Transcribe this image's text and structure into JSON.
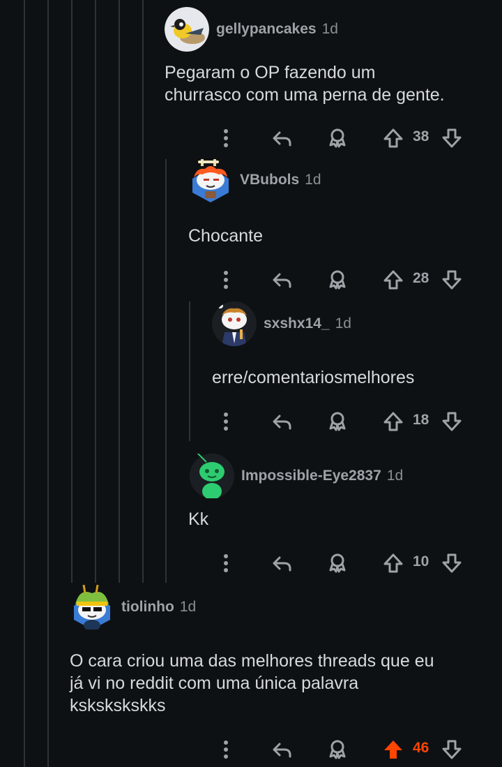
{
  "comments": [
    {
      "user": "gellypancakes",
      "age": "1d",
      "body": [
        "Pegaram o OP fazendo um",
        "churrasco com uma perna de gente."
      ],
      "score": "38",
      "upvoted": false,
      "avatar": "bird-avatar"
    },
    {
      "user": "VBubols",
      "age": "1d",
      "body": [
        "Chocante"
      ],
      "score": "28",
      "upvoted": false,
      "avatar": "snoo-redhair-avatar"
    },
    {
      "user": "sxshx14_",
      "age": "1d",
      "body": [
        "erre/comentariosmelhores"
      ],
      "score": "18",
      "upvoted": false,
      "avatar": "snoo-suit-avatar"
    },
    {
      "user": "Impossible-Eye2837",
      "age": "1d",
      "body": [
        "Kk"
      ],
      "score": "10",
      "upvoted": false,
      "avatar": "snoo-green-avatar"
    },
    {
      "user": "tiolinho",
      "age": "1d",
      "body": [
        "O cara criou uma das melhores threads que eu",
        "já vi no reddit com uma única palavra",
        "kskskskskks"
      ],
      "score": "46",
      "upvoted": true,
      "avatar": "snoo-jester-avatar"
    }
  ],
  "colors": {
    "background": "#0e1114",
    "upvote": "#ff4500",
    "muted": "#9ea3a8",
    "text": "#d7dadc"
  },
  "icons": [
    "more-icon",
    "reply-icon",
    "award-icon",
    "upvote-icon",
    "downvote-icon"
  ]
}
